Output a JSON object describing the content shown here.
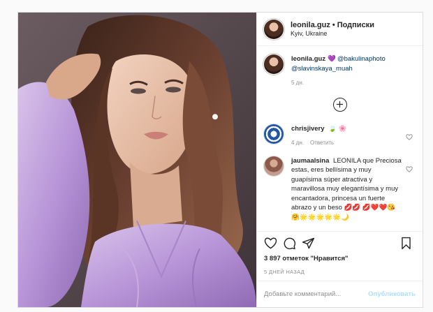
{
  "header": {
    "username": "leonila.guz",
    "separator": "•",
    "follow_label": "Подписки",
    "location": "Kyiv, Ukraine"
  },
  "caption": {
    "username": "leonila.guz",
    "heart": "💜",
    "mention1": "@bakulinaphoto",
    "mention2": "@slavinskaya_muah",
    "time": "5 дн."
  },
  "comments": [
    {
      "username": "chrisjivery",
      "text": "🍃 🌸",
      "time": "4 дн.",
      "reply_label": "Ответить"
    },
    {
      "username": "jaumaalsina",
      "text": "LEONILA que Preciosa estas, eres bellísima y muy guapísima súper atractiva y maravillosa muy elegantísima y muy encantadora, princesa un fuerte abrazo y un beso 💋💋 💋❤️❤️😘🤗🌟🌟🌟🌟🌟🌙"
    }
  ],
  "post": {
    "likes": "3 897 отметок \"Нравится\"",
    "ago": "5 ДНЕЙ НАЗАД"
  },
  "composer": {
    "placeholder": "Добавьте комментарий...",
    "publish_label": "Опубликовать"
  },
  "colors": {
    "accent": "#0095f6",
    "publish_disabled": "#b2dffc",
    "mention": "#00376b"
  }
}
